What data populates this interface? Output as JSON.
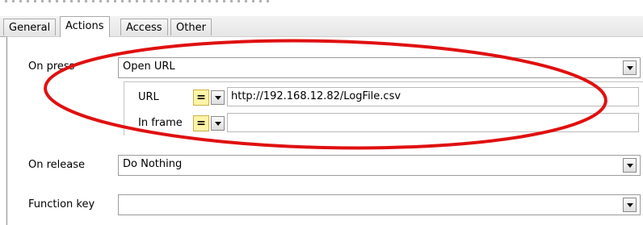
{
  "tabs": [
    {
      "label": "General"
    },
    {
      "label": "Actions"
    },
    {
      "label": "Access"
    },
    {
      "label": "Other"
    }
  ],
  "on_press": {
    "label": "On press",
    "value": "Open URL",
    "url": {
      "label": "URL",
      "eq": "=",
      "value": "http://192.168.12.82/LogFile.csv"
    },
    "in_frame": {
      "label": "In frame",
      "eq": "=",
      "value": ""
    }
  },
  "on_release": {
    "label": "On release",
    "value": "Do Nothing"
  },
  "function_key": {
    "label": "Function key",
    "value": ""
  },
  "colors": {
    "highlight_ellipse": "#e01010",
    "eq_button": "#fff3a6"
  }
}
